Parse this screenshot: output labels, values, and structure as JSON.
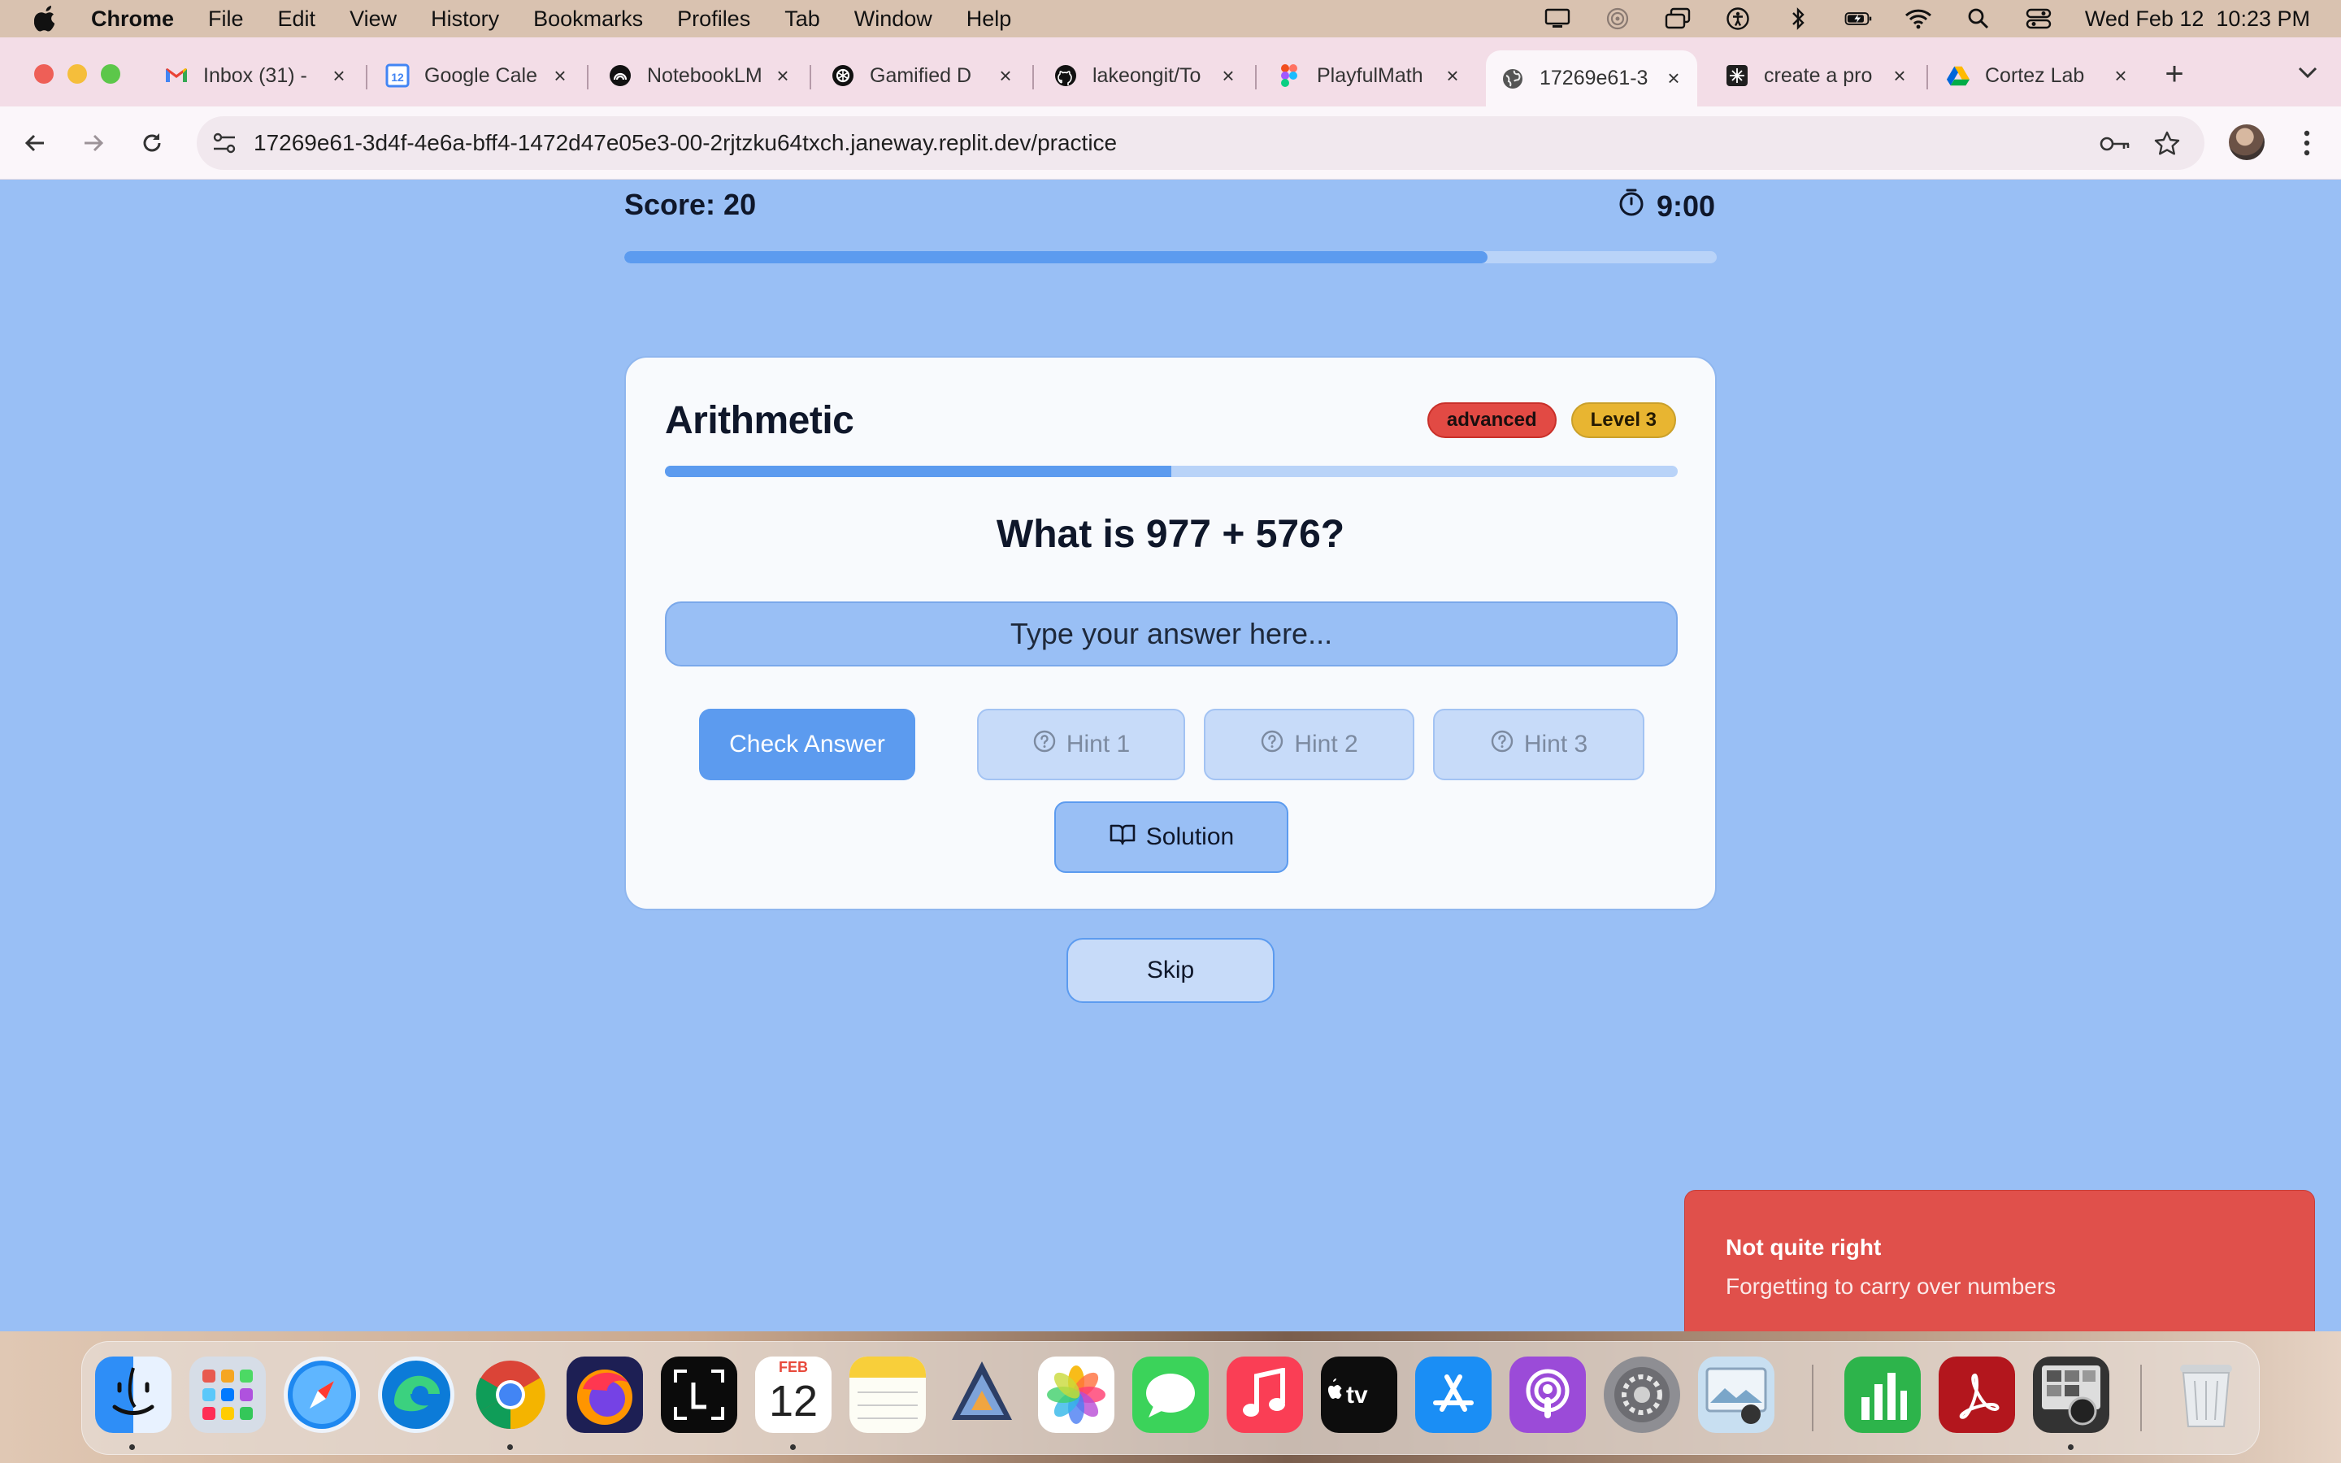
{
  "menubar": {
    "app": "Chrome",
    "items": [
      "File",
      "Edit",
      "View",
      "History",
      "Bookmarks",
      "Profiles",
      "Tab",
      "Window",
      "Help"
    ],
    "datetime": "Wed Feb 12  10:23 PM"
  },
  "tabs": [
    {
      "label": "Inbox (31) -",
      "icon": "gmail-icon"
    },
    {
      "label": "Google Cale",
      "icon": "google-calendar-icon"
    },
    {
      "label": "NotebookLM",
      "icon": "notebooklm-icon"
    },
    {
      "label": "Gamified D",
      "icon": "openai-icon"
    },
    {
      "label": "lakeongit/To",
      "icon": "github-icon"
    },
    {
      "label": "PlayfulMath",
      "icon": "figma-icon"
    },
    {
      "label": "17269e61-3",
      "icon": "globe-icon",
      "active": true
    },
    {
      "label": "create a pro",
      "icon": "app-icon"
    },
    {
      "label": "Cortez Lab",
      "icon": "google-drive-icon"
    }
  ],
  "address_bar": {
    "url": "17269e61-3d4f-4e6a-bff4-1472d47e05e3-00-2rjtzku64txch.janeway.replit.dev/practice"
  },
  "game": {
    "score_label": "Score: 20",
    "timer": "9:00",
    "session_progress": 0.79,
    "category": "Arithmetic",
    "difficulty": "advanced",
    "level": "Level 3",
    "question_progress": 0.5,
    "question": "What is 977 + 576?",
    "answer_placeholder": "Type your answer here...",
    "answer_value": "",
    "check_label": "Check Answer",
    "hint1_label": "Hint 1",
    "hint2_label": "Hint 2",
    "hint3_label": "Hint 3",
    "solution_label": "Solution",
    "skip_label": "Skip"
  },
  "toast": {
    "title": "Not quite right",
    "message": "Forgetting to carry over numbers"
  },
  "dock": {
    "calendar_month": "FEB",
    "calendar_day": "12"
  },
  "colors": {
    "page_bg": "#99bff5",
    "accent": "#5c9bef",
    "difficulty_badge": "#e24a44",
    "level_badge": "#e8b531",
    "toast_bg": "#e0504b"
  }
}
